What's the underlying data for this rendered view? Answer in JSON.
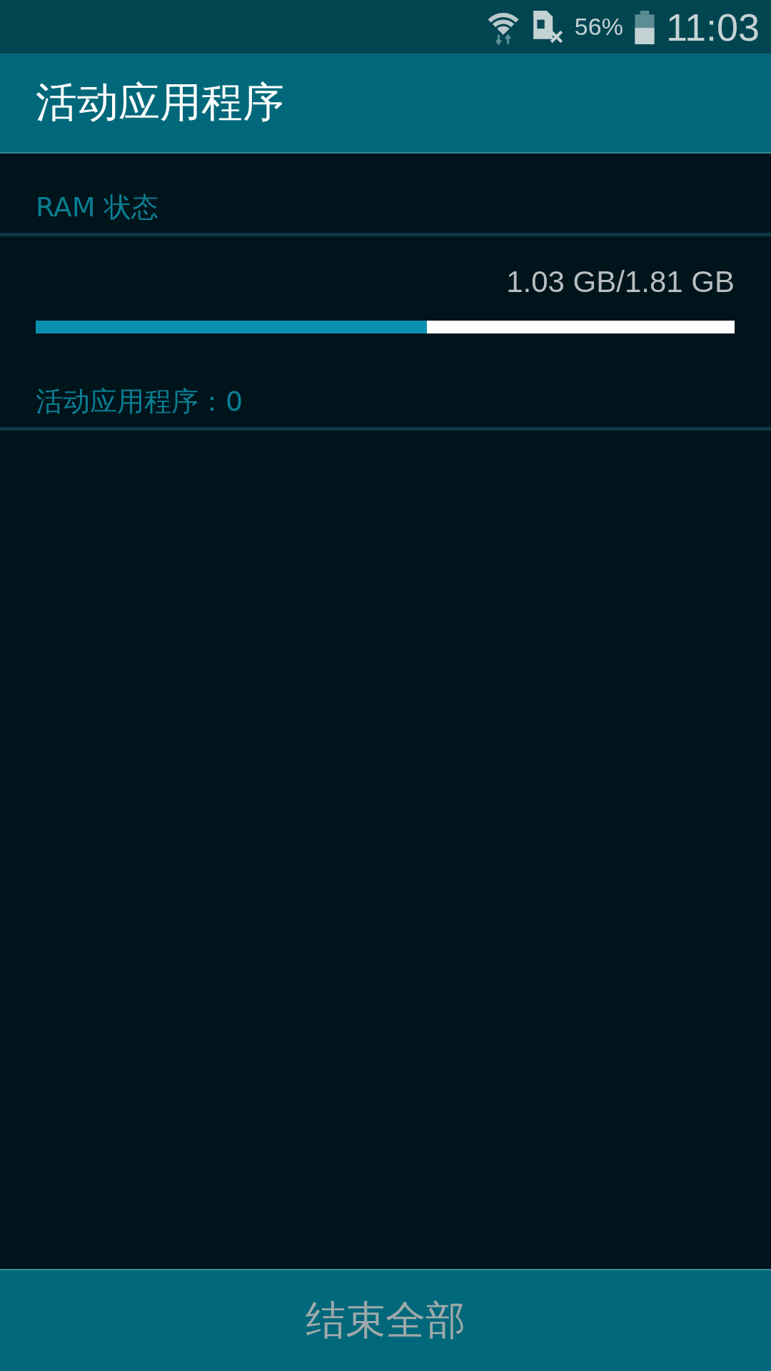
{
  "status_bar": {
    "battery_text": "56%",
    "time": "11:03"
  },
  "app_bar": {
    "title": "活动应用程序"
  },
  "ram_section": {
    "header": "RAM 状态",
    "reading": "1.03 GB/1.81 GB",
    "level": 0.56
  },
  "apps_section": {
    "header": "活动应用程序：0"
  },
  "bottom_button": {
    "label": "结束全部"
  }
}
